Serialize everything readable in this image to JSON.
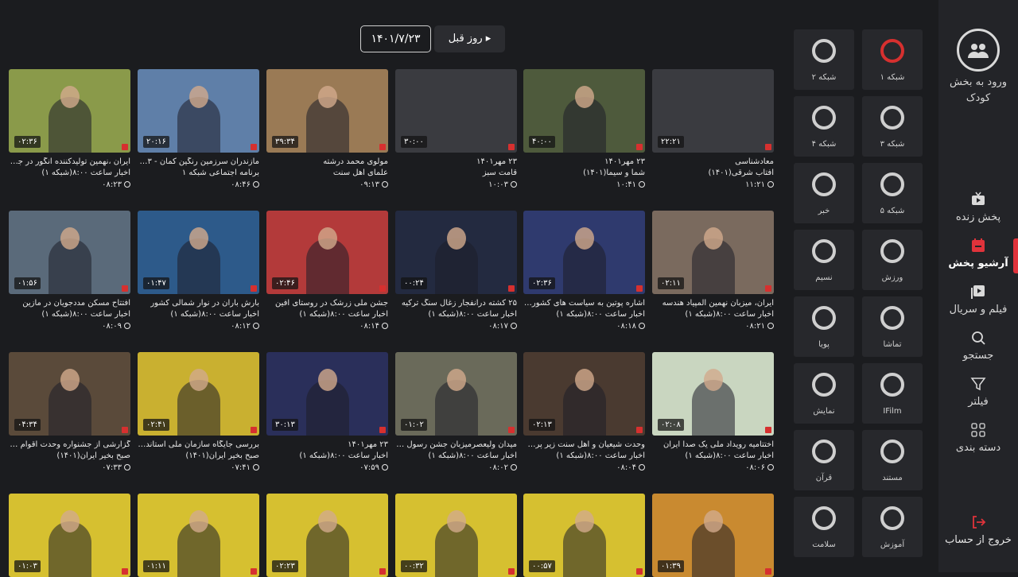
{
  "sidebar": {
    "kids_label_1": "ورود به بخش",
    "kids_label_2": "کودک",
    "nav": [
      {
        "label": "پخش زنده",
        "icon": "live-tv-icon"
      },
      {
        "label": "آرشیو پخش",
        "icon": "calendar-icon",
        "active": true
      },
      {
        "label": "فیلم و سریال",
        "icon": "film-icon"
      },
      {
        "label": "جستجو",
        "icon": "search-icon"
      },
      {
        "label": "فیلتر",
        "icon": "filter-icon"
      },
      {
        "label": "دسته بندی",
        "icon": "grid-icon"
      }
    ],
    "logout": "خروج از حساب",
    "accent_color": "#e0333b"
  },
  "channels": [
    {
      "name": "شبکه ۱"
    },
    {
      "name": "شبکه ۲"
    },
    {
      "name": "شبکه ۳"
    },
    {
      "name": "شبکه ۴"
    },
    {
      "name": "شبکه ۵"
    },
    {
      "name": "خبر"
    },
    {
      "name": "ورزش"
    },
    {
      "name": "نسیم"
    },
    {
      "name": "تماشا"
    },
    {
      "name": "پویا"
    },
    {
      "name": "IFilm"
    },
    {
      "name": "نمایش"
    },
    {
      "name": "مستند"
    },
    {
      "name": "قرآن"
    },
    {
      "name": "آموزش"
    },
    {
      "name": "سلامت"
    }
  ],
  "topbar": {
    "date": "۱۴۰۱/۷/۲۳",
    "prev_day": "روز قبل"
  },
  "programs": [
    {
      "title": "معادشناسی",
      "subtitle": "آفتاب شرقی(۱۴۰۱)",
      "time": "۱۱:۲۱",
      "duration": "۲۲:۲۱",
      "bg": "#3a3b40"
    },
    {
      "title": "۲۳ مهر۱۴۰۱",
      "subtitle": "شما و سیما(۱۴۰۱)",
      "time": "۱۰:۴۱",
      "duration": "۴۰:۰۰",
      "bg": "#4e5a3c"
    },
    {
      "title": "۲۳ مهر۱۴۰۱",
      "subtitle": "قامت سبز",
      "time": "۱۰:۰۳",
      "duration": "۳۰:۰۰",
      "bg": "#3a3b40"
    },
    {
      "title": "مولوی محمد درشته",
      "subtitle": "علمای اهل سنت",
      "time": "۰۹:۱۳",
      "duration": "۳۹:۳۴",
      "bg": "#9a7a55"
    },
    {
      "title": "مازندران سرزمین رنگین کمان - ۲۳ م...",
      "subtitle": "برنامه اجتماعی شبکه ۱",
      "time": "۰۸:۴۶",
      "duration": "۲۰:۱۶",
      "bg": "#5f7fa8"
    },
    {
      "title": "ایران ،نهمین تولیدکننده انگور در جهان",
      "subtitle": "اخبار ساعت ۸:۰۰(شبکه ۱)",
      "time": "۰۸:۲۳",
      "duration": "۰۲:۳۶",
      "bg": "#8a9a4a"
    },
    {
      "title": "ایران، میزبان نهمین المپیاد هندسه",
      "subtitle": "اخبار ساعت ۸:۰۰(شبکه ۱)",
      "time": "۰۸:۲۱",
      "duration": "۰۲:۱۱",
      "bg": "#7a6a5e"
    },
    {
      "title": "اشاره پوتین به سیاست های کشورها...",
      "subtitle": "اخبار ساعت ۸:۰۰(شبکه ۱)",
      "time": "۰۸:۱۸",
      "duration": "۰۲:۳۶",
      "bg": "#2f3a6e"
    },
    {
      "title": "۲۵ کشته درانفجار زغال سنگ ترکیه",
      "subtitle": "اخبار ساعت ۸:۰۰(شبکه ۱)",
      "time": "۰۸:۱۷",
      "duration": "۰۰:۲۴",
      "bg": "#232a40"
    },
    {
      "title": "جشن ملی زرشک در روستای افین",
      "subtitle": "اخبار ساعت ۸:۰۰(شبکه ۱)",
      "time": "۰۸:۱۴",
      "duration": "۰۲:۴۶",
      "bg": "#b33a3a"
    },
    {
      "title": "بارش باران در نوار شمالی کشور",
      "subtitle": "اخبار ساعت ۸:۰۰(شبکه ۱)",
      "time": "۰۸:۱۲",
      "duration": "۰۱:۴۷",
      "bg": "#2d5a8a"
    },
    {
      "title": "افتتاح مسکن مددجویان در مازین",
      "subtitle": "اخبار ساعت ۸:۰۰(شبکه ۱)",
      "time": "۰۸:۰۹",
      "duration": "۰۱:۵۶",
      "bg": "#5a6a7a"
    },
    {
      "title": "اختتامیه رویداد ملی یک صدا ایران",
      "subtitle": "اخبار ساعت ۸:۰۰(شبکه ۱)",
      "time": "۰۸:۰۶",
      "duration": "۰۲:۰۸",
      "bg": "#c9d6c0"
    },
    {
      "title": "وحدت شیعیان و اهل سنت زیر پرچم...",
      "subtitle": "اخبار ساعت ۸:۰۰(شبکه ۱)",
      "time": "۰۸:۰۴",
      "duration": "۰۲:۱۳",
      "bg": "#4a3a30"
    },
    {
      "title": "میدان ولیعصرمیزبان جشن رسول م...",
      "subtitle": "اخبار ساعت ۸:۰۰(شبکه ۱)",
      "time": "۰۸:۰۲",
      "duration": "۰۱:۰۲",
      "bg": "#6a6a5a"
    },
    {
      "title": "۲۳ مهر۱۴۰۱",
      "subtitle": "اخبار ساعت ۸:۰۰(شبکه ۱)",
      "time": "۰۷:۵۹",
      "duration": "۳۰:۱۳",
      "bg": "#2a2f5a"
    },
    {
      "title": "بررسی جایگاه سازمان ملی استاندارد...",
      "subtitle": "صبح بخیر ایران(۱۴۰۱)",
      "time": "۰۷:۴۱",
      "duration": "۰۲:۴۱",
      "bg": "#c9b030"
    },
    {
      "title": "گزارشی از جشنواره وحدت اقوام ایرانی",
      "subtitle": "صبح بخیر ایران(۱۴۰۱)",
      "time": "۰۷:۳۳",
      "duration": "۰۴:۳۴",
      "bg": "#5a4a3a"
    },
    {
      "title": "",
      "subtitle": "",
      "time": "",
      "duration": "۰۱:۳۹",
      "bg": "#c98a30"
    },
    {
      "title": "",
      "subtitle": "",
      "time": "",
      "duration": "۰۰:۵۷",
      "bg": "#d6c030"
    },
    {
      "title": "",
      "subtitle": "",
      "time": "",
      "duration": "۰۰:۳۲",
      "bg": "#d6c030"
    },
    {
      "title": "",
      "subtitle": "",
      "time": "",
      "duration": "۰۲:۲۳",
      "bg": "#d6c030"
    },
    {
      "title": "",
      "subtitle": "",
      "time": "",
      "duration": "۰۱:۱۱",
      "bg": "#d6c030"
    },
    {
      "title": "",
      "subtitle": "",
      "time": "",
      "duration": "۰۱:۰۳",
      "bg": "#d6c030"
    }
  ]
}
